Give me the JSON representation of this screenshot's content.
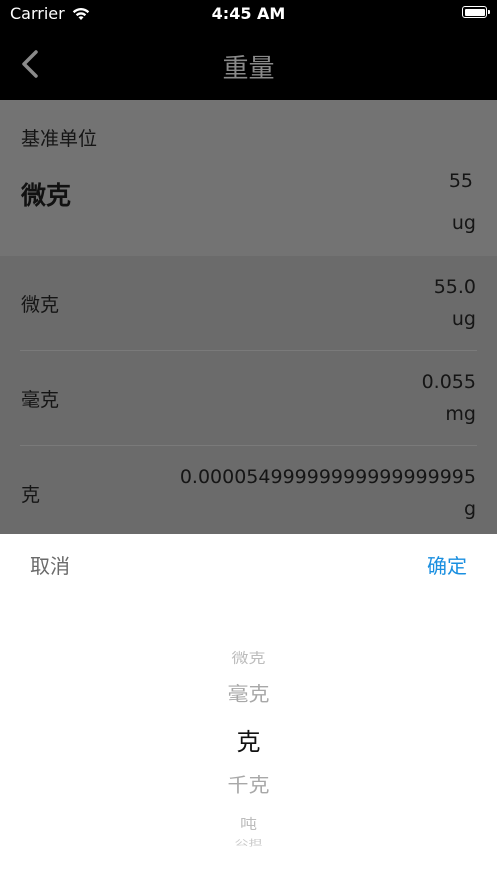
{
  "status_bar": {
    "carrier": "Carrier",
    "time": "4:45 AM"
  },
  "nav": {
    "title": "重量",
    "back_icon": "chevron-left-icon"
  },
  "base": {
    "caption": "基准单位",
    "unit": "微克",
    "value": "55",
    "symbol": "ug"
  },
  "rows": [
    {
      "name": "微克",
      "value": "55.0",
      "symbol": "ug"
    },
    {
      "name": "毫克",
      "value": "0.055",
      "symbol": "mg"
    },
    {
      "name": "克",
      "value": "0.00005499999999999999995",
      "symbol": "g"
    }
  ],
  "sheet": {
    "cancel_label": "取消",
    "confirm_label": "确定"
  },
  "picker": {
    "selected": "克",
    "items": [
      "微克",
      "毫克",
      "克",
      "千克",
      "吨",
      "公担"
    ]
  },
  "colors": {
    "accent": "#1a8fe0",
    "overlay": "#6b6b6b"
  }
}
